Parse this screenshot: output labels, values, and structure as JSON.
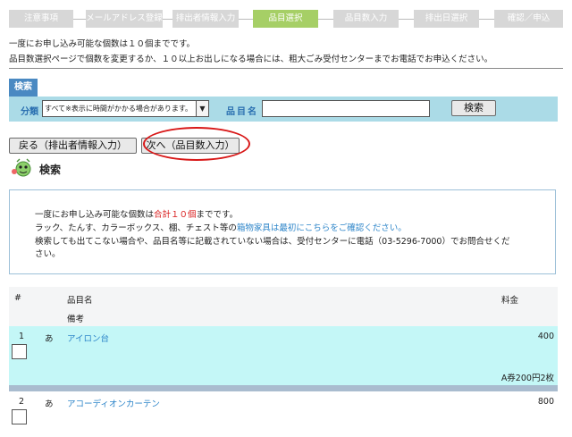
{
  "steps": [
    {
      "label": "注意事項",
      "active": false
    },
    {
      "label": "メールアドレス登録",
      "active": false
    },
    {
      "label": "排出者情報入力",
      "active": false
    },
    {
      "label": "品目選択",
      "active": true
    },
    {
      "label": "品目数入力",
      "active": false
    },
    {
      "label": "排出日選択",
      "active": false
    },
    {
      "label": "確認／申込",
      "active": false
    }
  ],
  "intro": {
    "line1": "一度にお申し込み可能な個数は１０個までです。",
    "line2": "品目数選択ページで個数を変更するか、１０以上お出しになる場合には、粗大ごみ受付センターまでお電話でお申込ください。"
  },
  "search": {
    "tab_label": "検索",
    "category_label": "分類",
    "category_value": "すべて※表示に時間がかかる場合があります。",
    "item_label": "品目名",
    "item_value": "",
    "button": "検索"
  },
  "nav": {
    "back": "戻る（排出者情報入力）",
    "next": "次へ（品目数入力）"
  },
  "search_heading": "検索",
  "notice": {
    "l1_a": "一度にお申し込み可能な個数は",
    "l1_red": "合計１０個",
    "l1_b": "までです。",
    "l2_a": "ラック、たんす、カラーボックス、棚、チェスト等の",
    "l2_link": "箱物家具は最初にこちらをご確認ください。",
    "l3": "検索しても出てこない場合や、品目名等に記載されていない場合は、受付センターに電話（03-5296-7000）でお問合せくだ",
    "l4": "さい。"
  },
  "table": {
    "col_num": "#",
    "col_name": "品目名",
    "col_price": "料金",
    "col_note": "備考",
    "rows": [
      {
        "num": "1",
        "kana": "あ",
        "name": "アイロン台",
        "price": "400",
        "note": "A券200円2枚"
      },
      {
        "num": "2",
        "kana": "あ",
        "name": "アコーディオンカーテン",
        "price": "800",
        "note": ""
      }
    ]
  },
  "colors": {
    "step_active": "#a6cf66",
    "step_inactive": "#d7d7d7",
    "search_bar": "#abdbe7",
    "row_highlight": "#c4f7f7",
    "link": "#2d85c9",
    "alert": "#d81818"
  }
}
